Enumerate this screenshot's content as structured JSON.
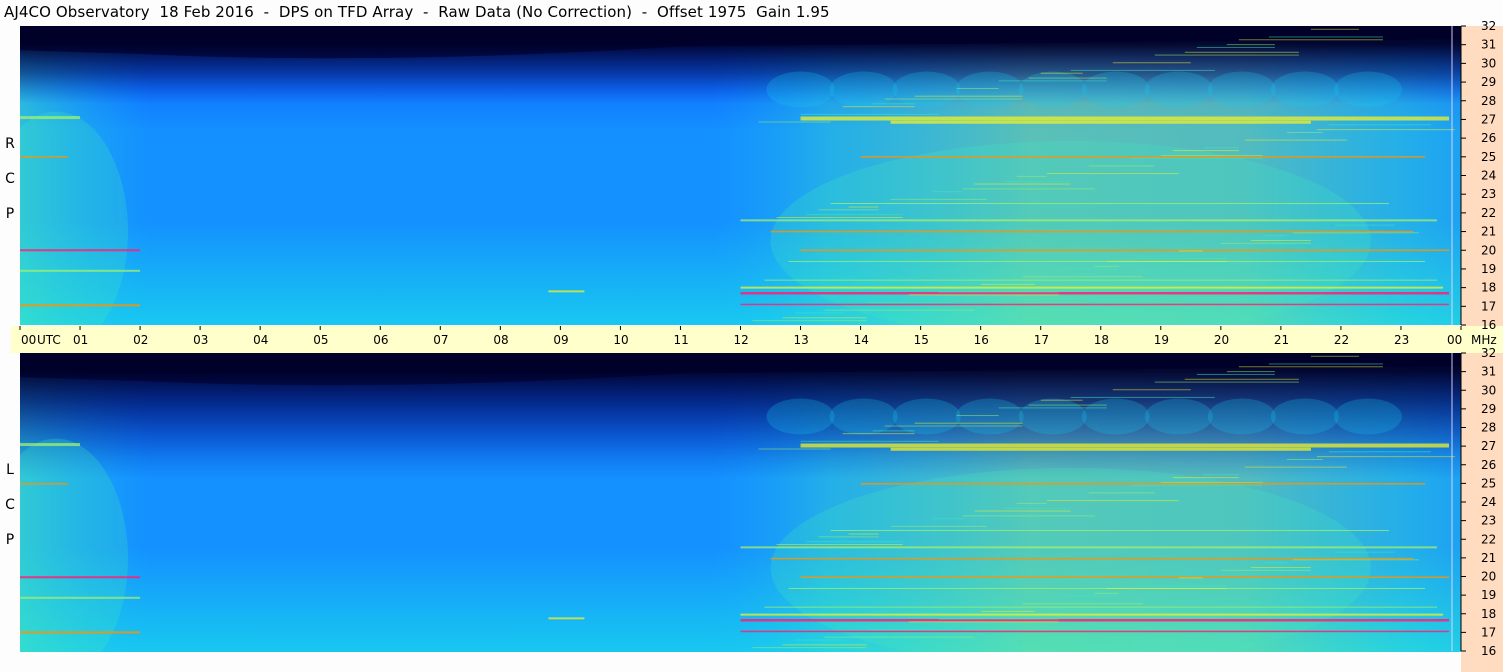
{
  "title": "AJ4CO Observatory  18 Feb 2016  -  DPS on TFD Array  -  Raw Data (No Correction)  -  Offset 1975  Gain 1.95",
  "panels": [
    {
      "name": "rcp",
      "side_label": [
        "R",
        "C",
        "P"
      ]
    },
    {
      "name": "lcp",
      "side_label": [
        "L",
        "C",
        "P"
      ]
    }
  ],
  "colors": {
    "background": "#ffffff",
    "time_bar": "#ffffcc",
    "freq_strip": "#ffdcc0",
    "colormap": [
      "#000028",
      "#001060",
      "#0028c8",
      "#0a50ff",
      "#1490ff",
      "#18c8f0",
      "#40e8c0",
      "#a0f070",
      "#f0f028",
      "#ff9000",
      "#ff1e78"
    ]
  },
  "chart_data": {
    "type": "heatmap",
    "title": "AJ4CO Observatory  18 Feb 2016  -  DPS on TFD Array  -  Raw Data (No Correction)  -  Offset 1975  Gain 1.95",
    "xlabel": "UTC",
    "ylabel": "MHz",
    "x_ticks": [
      "00",
      "01",
      "02",
      "03",
      "04",
      "05",
      "06",
      "07",
      "08",
      "09",
      "10",
      "11",
      "12",
      "13",
      "14",
      "15",
      "16",
      "17",
      "18",
      "19",
      "20",
      "21",
      "22",
      "23",
      "00"
    ],
    "xlim": [
      0,
      24
    ],
    "y_ticks": [
      "32",
      "31",
      "30",
      "29",
      "28",
      "27",
      "26",
      "25",
      "24",
      "23",
      "22",
      "21",
      "20",
      "19",
      "18",
      "17",
      "16"
    ],
    "ylim": [
      16,
      32
    ],
    "grid": false,
    "series": [
      {
        "name": "RCP"
      },
      {
        "name": "LCP"
      }
    ]
  }
}
